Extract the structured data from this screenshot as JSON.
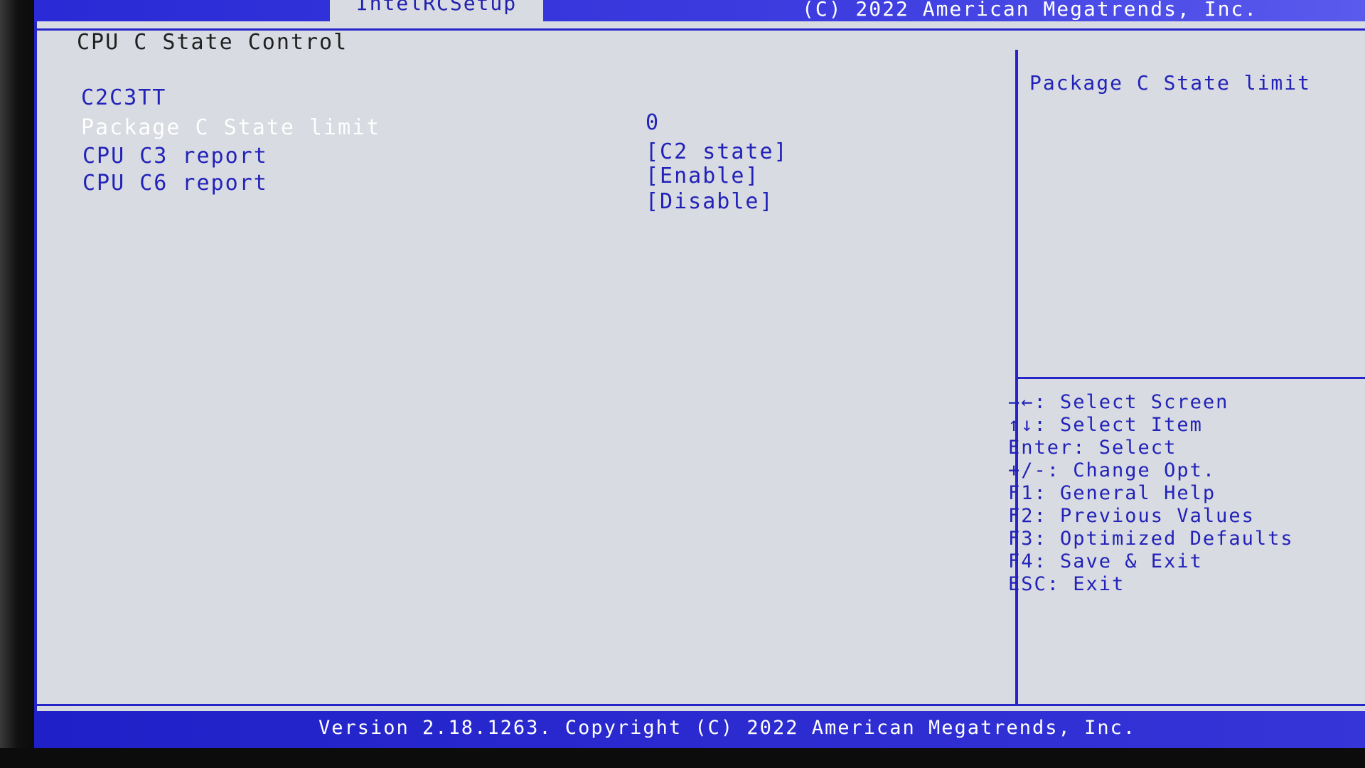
{
  "header": {
    "tab_label": "IntelRCSetup",
    "copyright": "(C) 2022 American Megatrends, Inc."
  },
  "page": {
    "title": "CPU C State Control"
  },
  "settings": [
    {
      "label": "C2C3TT",
      "value": "0"
    },
    {
      "label": "Package C State limit",
      "value": "[C2 state]"
    },
    {
      "label": "CPU C3 report",
      "value": "[Enable]"
    },
    {
      "label": "CPU C6 report",
      "value": "[Disable]"
    }
  ],
  "help": {
    "title": "Package C State limit"
  },
  "keys": [
    "→←: Select Screen",
    "↑↓: Select Item",
    "Enter: Select",
    "+/-: Change Opt.",
    "F1: General Help",
    "F2: Previous Values",
    "F3: Optimized Defaults",
    "F4: Save & Exit",
    "ESC: Exit"
  ],
  "footer": {
    "text": "Version 2.18.1263. Copyright (C) 2022 American Megatrends, Inc."
  },
  "colors": {
    "accent": "#2626c8",
    "background": "#d8dbe2",
    "selected_text": "#ffffff"
  }
}
